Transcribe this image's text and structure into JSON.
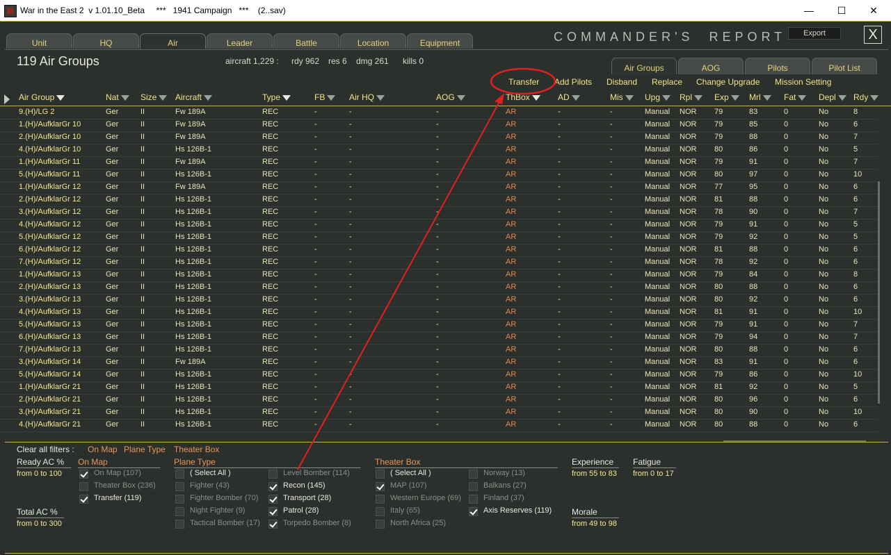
{
  "window": {
    "title": "War in the East 2  v 1.01.10_Beta     ***   1941 Campaign   ***    (2..sav)"
  },
  "tabs": [
    "Unit",
    "HQ",
    "Air",
    "Leader",
    "Battle",
    "Location",
    "Equipment"
  ],
  "report_title": "COMMANDER'S  REPORT",
  "export_label": "Export",
  "close_label": "X",
  "summary": {
    "count_title": "119 Air Groups",
    "aircraft": "aircraft 1,229 :",
    "rdy": "rdy 962",
    "res": "res 6",
    "dmg": "dmg 261",
    "kills": "kills 0"
  },
  "right_tabs": [
    "Air Groups",
    "AOG",
    "Pilots",
    "Pilot List"
  ],
  "actions": [
    "Transfer",
    "Add Pilots",
    "Disband",
    "Replace",
    "Change Upgrade",
    "Mission Setting"
  ],
  "columns": [
    "Air Group",
    "Nat",
    "Size",
    "Aircraft",
    "Type",
    "FB",
    "Air HQ",
    "AOG",
    "ThBox",
    "AD",
    "Mis",
    "Upg",
    "Rpl",
    "Exp",
    "Mrl",
    "Fat",
    "Depl",
    "Rdy"
  ],
  "rows": [
    [
      "9.(H)/LG 2",
      "Ger",
      "II",
      "Fw 189A",
      "REC",
      "-",
      "-",
      "-",
      "AR",
      "-",
      "-",
      "Manual",
      "NOR",
      "79",
      "83",
      "0",
      "No",
      "8"
    ],
    [
      "1.(H)/AufklarGr 10",
      "Ger",
      "II",
      "Fw 189A",
      "REC",
      "-",
      "-",
      "-",
      "AR",
      "-",
      "-",
      "Manual",
      "NOR",
      "79",
      "85",
      "0",
      "No",
      "6"
    ],
    [
      "2.(H)/AufklarGr 10",
      "Ger",
      "II",
      "Fw 189A",
      "REC",
      "-",
      "-",
      "-",
      "AR",
      "-",
      "-",
      "Manual",
      "NOR",
      "79",
      "88",
      "0",
      "No",
      "7"
    ],
    [
      "4.(H)/AufklarGr 10",
      "Ger",
      "II",
      "Hs 126B-1",
      "REC",
      "-",
      "-",
      "-",
      "AR",
      "-",
      "-",
      "Manual",
      "NOR",
      "80",
      "86",
      "0",
      "No",
      "5"
    ],
    [
      "1.(H)/AufklarGr 11",
      "Ger",
      "II",
      "Fw 189A",
      "REC",
      "-",
      "-",
      "-",
      "AR",
      "-",
      "-",
      "Manual",
      "NOR",
      "79",
      "91",
      "0",
      "No",
      "7"
    ],
    [
      "5.(H)/AufklarGr 11",
      "Ger",
      "II",
      "Hs 126B-1",
      "REC",
      "-",
      "-",
      "-",
      "AR",
      "-",
      "-",
      "Manual",
      "NOR",
      "80",
      "97",
      "0",
      "No",
      "10"
    ],
    [
      "1.(H)/AufklarGr 12",
      "Ger",
      "II",
      "Fw 189A",
      "REC",
      "-",
      "-",
      "-",
      "AR",
      "-",
      "-",
      "Manual",
      "NOR",
      "77",
      "95",
      "0",
      "No",
      "6"
    ],
    [
      "2.(H)/AufklarGr 12",
      "Ger",
      "II",
      "Hs 126B-1",
      "REC",
      "-",
      "-",
      "-",
      "AR",
      "-",
      "-",
      "Manual",
      "NOR",
      "81",
      "88",
      "0",
      "No",
      "6"
    ],
    [
      "3.(H)/AufklarGr 12",
      "Ger",
      "II",
      "Hs 126B-1",
      "REC",
      "-",
      "-",
      "-",
      "AR",
      "-",
      "-",
      "Manual",
      "NOR",
      "78",
      "90",
      "0",
      "No",
      "7"
    ],
    [
      "4.(H)/AufklarGr 12",
      "Ger",
      "II",
      "Hs 126B-1",
      "REC",
      "-",
      "-",
      "-",
      "AR",
      "-",
      "-",
      "Manual",
      "NOR",
      "79",
      "91",
      "0",
      "No",
      "5"
    ],
    [
      "5.(H)/AufklarGr 12",
      "Ger",
      "II",
      "Hs 126B-1",
      "REC",
      "-",
      "-",
      "-",
      "AR",
      "-",
      "-",
      "Manual",
      "NOR",
      "79",
      "92",
      "0",
      "No",
      "5"
    ],
    [
      "6.(H)/AufklarGr 12",
      "Ger",
      "II",
      "Hs 126B-1",
      "REC",
      "-",
      "-",
      "-",
      "AR",
      "-",
      "-",
      "Manual",
      "NOR",
      "81",
      "88",
      "0",
      "No",
      "6"
    ],
    [
      "7.(H)/AufklarGr 12",
      "Ger",
      "II",
      "Hs 126B-1",
      "REC",
      "-",
      "-",
      "-",
      "AR",
      "-",
      "-",
      "Manual",
      "NOR",
      "78",
      "92",
      "0",
      "No",
      "6"
    ],
    [
      "1.(H)/AufklarGr 13",
      "Ger",
      "II",
      "Hs 126B-1",
      "REC",
      "-",
      "-",
      "-",
      "AR",
      "-",
      "-",
      "Manual",
      "NOR",
      "79",
      "84",
      "0",
      "No",
      "8"
    ],
    [
      "2.(H)/AufklarGr 13",
      "Ger",
      "II",
      "Hs 126B-1",
      "REC",
      "-",
      "-",
      "-",
      "AR",
      "-",
      "-",
      "Manual",
      "NOR",
      "80",
      "88",
      "0",
      "No",
      "6"
    ],
    [
      "3.(H)/AufklarGr 13",
      "Ger",
      "II",
      "Hs 126B-1",
      "REC",
      "-",
      "-",
      "-",
      "AR",
      "-",
      "-",
      "Manual",
      "NOR",
      "80",
      "92",
      "0",
      "No",
      "6"
    ],
    [
      "4.(H)/AufklarGr 13",
      "Ger",
      "II",
      "Hs 126B-1",
      "REC",
      "-",
      "-",
      "-",
      "AR",
      "-",
      "-",
      "Manual",
      "NOR",
      "81",
      "91",
      "0",
      "No",
      "10"
    ],
    [
      "5.(H)/AufklarGr 13",
      "Ger",
      "II",
      "Hs 126B-1",
      "REC",
      "-",
      "-",
      "-",
      "AR",
      "-",
      "-",
      "Manual",
      "NOR",
      "79",
      "91",
      "0",
      "No",
      "7"
    ],
    [
      "6.(H)/AufklarGr 13",
      "Ger",
      "II",
      "Hs 126B-1",
      "REC",
      "-",
      "-",
      "-",
      "AR",
      "-",
      "-",
      "Manual",
      "NOR",
      "79",
      "94",
      "0",
      "No",
      "7"
    ],
    [
      "7.(H)/AufklarGr 13",
      "Ger",
      "II",
      "Hs 126B-1",
      "REC",
      "-",
      "-",
      "-",
      "AR",
      "-",
      "-",
      "Manual",
      "NOR",
      "80",
      "88",
      "0",
      "No",
      "6"
    ],
    [
      "3.(H)/AufklarGr 14",
      "Ger",
      "II",
      "Fw 189A",
      "REC",
      "-",
      "-",
      "-",
      "AR",
      "-",
      "-",
      "Manual",
      "NOR",
      "83",
      "91",
      "0",
      "No",
      "6"
    ],
    [
      "5.(H)/AufklarGr 14",
      "Ger",
      "II",
      "Hs 126B-1",
      "REC",
      "-",
      "-",
      "-",
      "AR",
      "-",
      "-",
      "Manual",
      "NOR",
      "79",
      "86",
      "0",
      "No",
      "10"
    ],
    [
      "1.(H)/AufklarGr 21",
      "Ger",
      "II",
      "Hs 126B-1",
      "REC",
      "-",
      "-",
      "-",
      "AR",
      "-",
      "-",
      "Manual",
      "NOR",
      "81",
      "92",
      "0",
      "No",
      "5"
    ],
    [
      "2.(H)/AufklarGr 21",
      "Ger",
      "II",
      "Hs 126B-1",
      "REC",
      "-",
      "-",
      "-",
      "AR",
      "-",
      "-",
      "Manual",
      "NOR",
      "80",
      "96",
      "0",
      "No",
      "6"
    ],
    [
      "3.(H)/AufklarGr 21",
      "Ger",
      "II",
      "Hs 126B-1",
      "REC",
      "-",
      "-",
      "-",
      "AR",
      "-",
      "-",
      "Manual",
      "NOR",
      "80",
      "90",
      "0",
      "No",
      "10"
    ],
    [
      "4.(H)/AufklarGr 21",
      "Ger",
      "II",
      "Hs 126B-1",
      "REC",
      "-",
      "-",
      "-",
      "AR",
      "-",
      "-",
      "Manual",
      "NOR",
      "80",
      "88",
      "0",
      "No",
      "6"
    ]
  ],
  "filters": {
    "clear_label": "Clear all filters :",
    "clear_links": [
      "On Map",
      "Plane Type",
      "Theater Box"
    ],
    "ready_ac": {
      "title": "Ready AC %",
      "range": "from 0 to 100"
    },
    "total_ac": {
      "title": "Total AC %",
      "range": "from 0 to 300"
    },
    "on_map": {
      "title": "On Map",
      "options": [
        {
          "label": "On Map (107)",
          "checked": true,
          "active": false
        },
        {
          "label": "Theater Box (236)",
          "checked": false,
          "active": false
        },
        {
          "label": "Transfer (119)",
          "checked": true,
          "active": true
        }
      ]
    },
    "plane_type": {
      "title": "Plane Type",
      "options": [
        {
          "label": "( Select All )",
          "checked": false,
          "active": true
        },
        {
          "label": "Fighter (43)",
          "checked": false,
          "active": false
        },
        {
          "label": "Fighter Bomber (70)",
          "checked": false,
          "active": false
        },
        {
          "label": "Night Fighter (9)",
          "checked": false,
          "active": false
        },
        {
          "label": "Tactical Bomber (17)",
          "checked": false,
          "active": false
        },
        {
          "label": "Level Bomber (114)",
          "checked": false,
          "active": false
        },
        {
          "label": "Recon (145)",
          "checked": true,
          "active": true
        },
        {
          "label": "Transport (28)",
          "checked": true,
          "active": true
        },
        {
          "label": "Patrol (28)",
          "checked": true,
          "active": true
        },
        {
          "label": "Torpedo Bomber (8)",
          "checked": true,
          "active": false
        }
      ]
    },
    "theater_box": {
      "title": "Theater Box",
      "options": [
        {
          "label": "( Select All )",
          "checked": false,
          "active": true
        },
        {
          "label": "MAP (107)",
          "checked": true,
          "active": false
        },
        {
          "label": "Western Europe (69)",
          "checked": false,
          "active": false
        },
        {
          "label": "Italy (65)",
          "checked": false,
          "active": false
        },
        {
          "label": "North Africa (25)",
          "checked": false,
          "active": false
        },
        {
          "label": "Norway (13)",
          "checked": false,
          "active": false
        },
        {
          "label": "Balkans (27)",
          "checked": false,
          "active": false
        },
        {
          "label": "Finland (37)",
          "checked": false,
          "active": false
        },
        {
          "label": "Axis Reserves (119)",
          "checked": true,
          "active": true
        }
      ]
    },
    "experience": {
      "title": "Experience",
      "range": "from 55 to 83"
    },
    "fatigue": {
      "title": "Fatigue",
      "range": "from 0 to 17"
    },
    "morale": {
      "title": "Morale",
      "range": "from 49 to 98"
    }
  },
  "colors": {
    "background": "#2c302d",
    "accent": "#c9b257",
    "text_gold": "#f0e489",
    "link_orange": "#e8955a",
    "annotation_red": "#e02020"
  }
}
